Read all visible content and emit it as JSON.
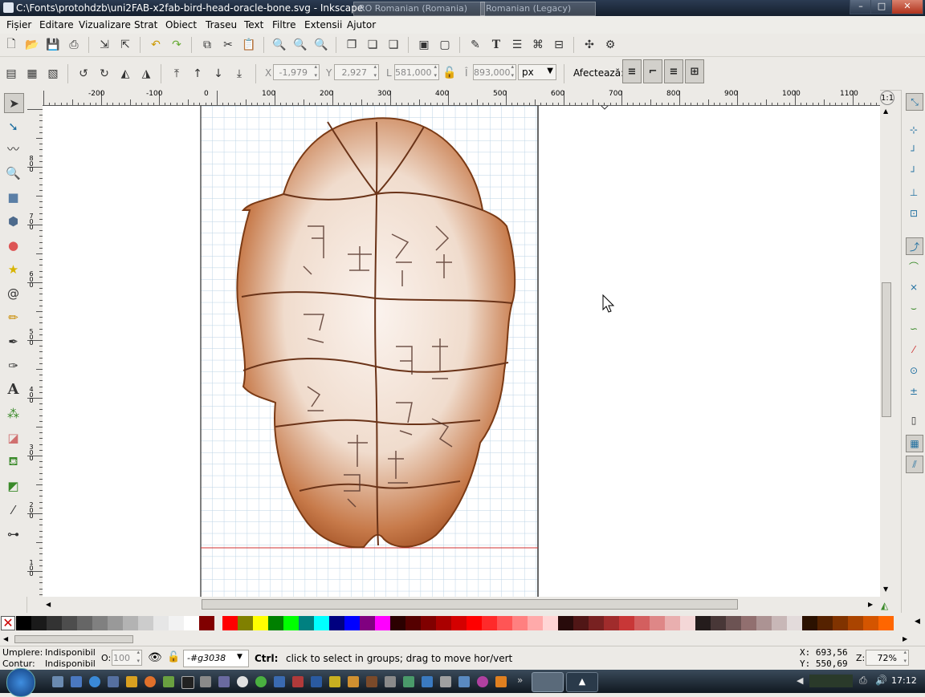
{
  "window": {
    "title": "C:\\Fonts\\protohdzb\\uni2FAB-x2fab-bird-head-oracle-bone.svg - Inkscape",
    "ime_primary": "RO Romanian (Romania)",
    "ime_secondary": "Romanian (Legacy)",
    "minimize": "–",
    "maximize": "□",
    "close": "✕"
  },
  "menu": [
    "Fișier",
    "Editare",
    "Vizualizare",
    "Strat",
    "Obiect",
    "Traseu",
    "Text",
    "Filtre",
    "Extensii",
    "Ajutor"
  ],
  "controls": {
    "x_label": "X",
    "x_value": "-1,979",
    "y_label": "Y",
    "y_value": "2,927",
    "w_label": "L",
    "w_value": "581,000",
    "h_label": "Î",
    "h_value": "893,000",
    "unit": "px",
    "affects_label": "Afectează:"
  },
  "rulers": {
    "h_ticks": [
      "-200",
      "-100",
      "0",
      "100",
      "200",
      "300",
      "400",
      "500",
      "600",
      "700",
      "800",
      "900",
      "1000",
      "1100"
    ],
    "v_ticks": [
      "800",
      "700",
      "600",
      "500",
      "400",
      "300",
      "200",
      "100"
    ]
  },
  "palette": [
    "#000000",
    "#1a1a1a",
    "#333333",
    "#4d4d4d",
    "#666666",
    "#808080",
    "#999999",
    "#b3b3b3",
    "#cccccc",
    "#e6e6e6",
    "#f2f2f2",
    "#ffffff",
    "#800000",
    "#ff0000",
    "#808000",
    "#ffff00",
    "#008000",
    "#00ff00",
    "#008080",
    "#00ffff",
    "#000080",
    "#0000ff",
    "#800080",
    "#ff00ff",
    "#2b0000",
    "#550000",
    "#800000",
    "#aa0000",
    "#d40000",
    "#ff0000",
    "#ff2a2a",
    "#ff5555",
    "#ff8080",
    "#ffaaaa",
    "#ffd5d5",
    "#280b0b",
    "#501616",
    "#782121",
    "#a02c2c",
    "#c83737",
    "#d35f5f",
    "#de8787",
    "#e9afaf",
    "#f4d7d7",
    "#241c1c",
    "#483737",
    "#6c5353",
    "#916f6f",
    "#ac9393",
    "#c8b7b7",
    "#e3dbdb",
    "#2b1100",
    "#552200",
    "#803300",
    "#aa4400",
    "#d45500",
    "#ff6600"
  ],
  "status": {
    "fill_label": "Umplere:",
    "fill_value": "Indisponibil",
    "stroke_label": "Contur:",
    "stroke_value": "Indisponibil",
    "opacity_label": "O:",
    "opacity_value": "100",
    "layer": "-#g3038",
    "message_bold": "Ctrl:",
    "message": "click to select in groups; drag to move hor/vert",
    "x_coord": "X:  693,56",
    "y_coord": "Y:  550,69",
    "zoom_label": "Z:",
    "zoom_value": "72%"
  },
  "taskbar": {
    "clock": "17:12"
  }
}
